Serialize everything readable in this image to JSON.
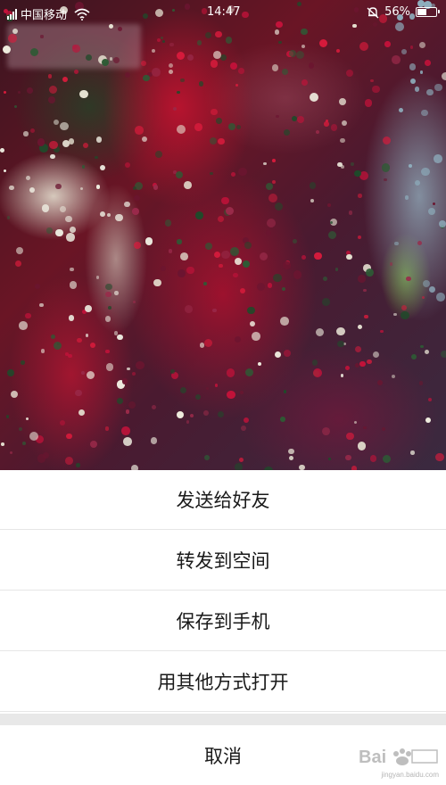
{
  "status_bar": {
    "carrier": "中国移动",
    "time": "14:47",
    "battery_percent_label": "56%",
    "battery_level": 0.56
  },
  "background": {
    "description_icon": "flower-field-photo"
  },
  "action_sheet": {
    "items": [
      {
        "label": "发送给好友"
      },
      {
        "label": "转发到空间"
      },
      {
        "label": "保存到手机"
      },
      {
        "label": "用其他方式打开"
      }
    ],
    "cancel_label": "取消"
  },
  "watermark": {
    "icon": "baidu-jingyan-logo",
    "url_text": "jingyan.baidu.com"
  },
  "colors": {
    "sheet_background": "#ffffff",
    "divider": "#e6e6e6",
    "gap": "#e8e8e8",
    "text": "#1a1a1a"
  }
}
